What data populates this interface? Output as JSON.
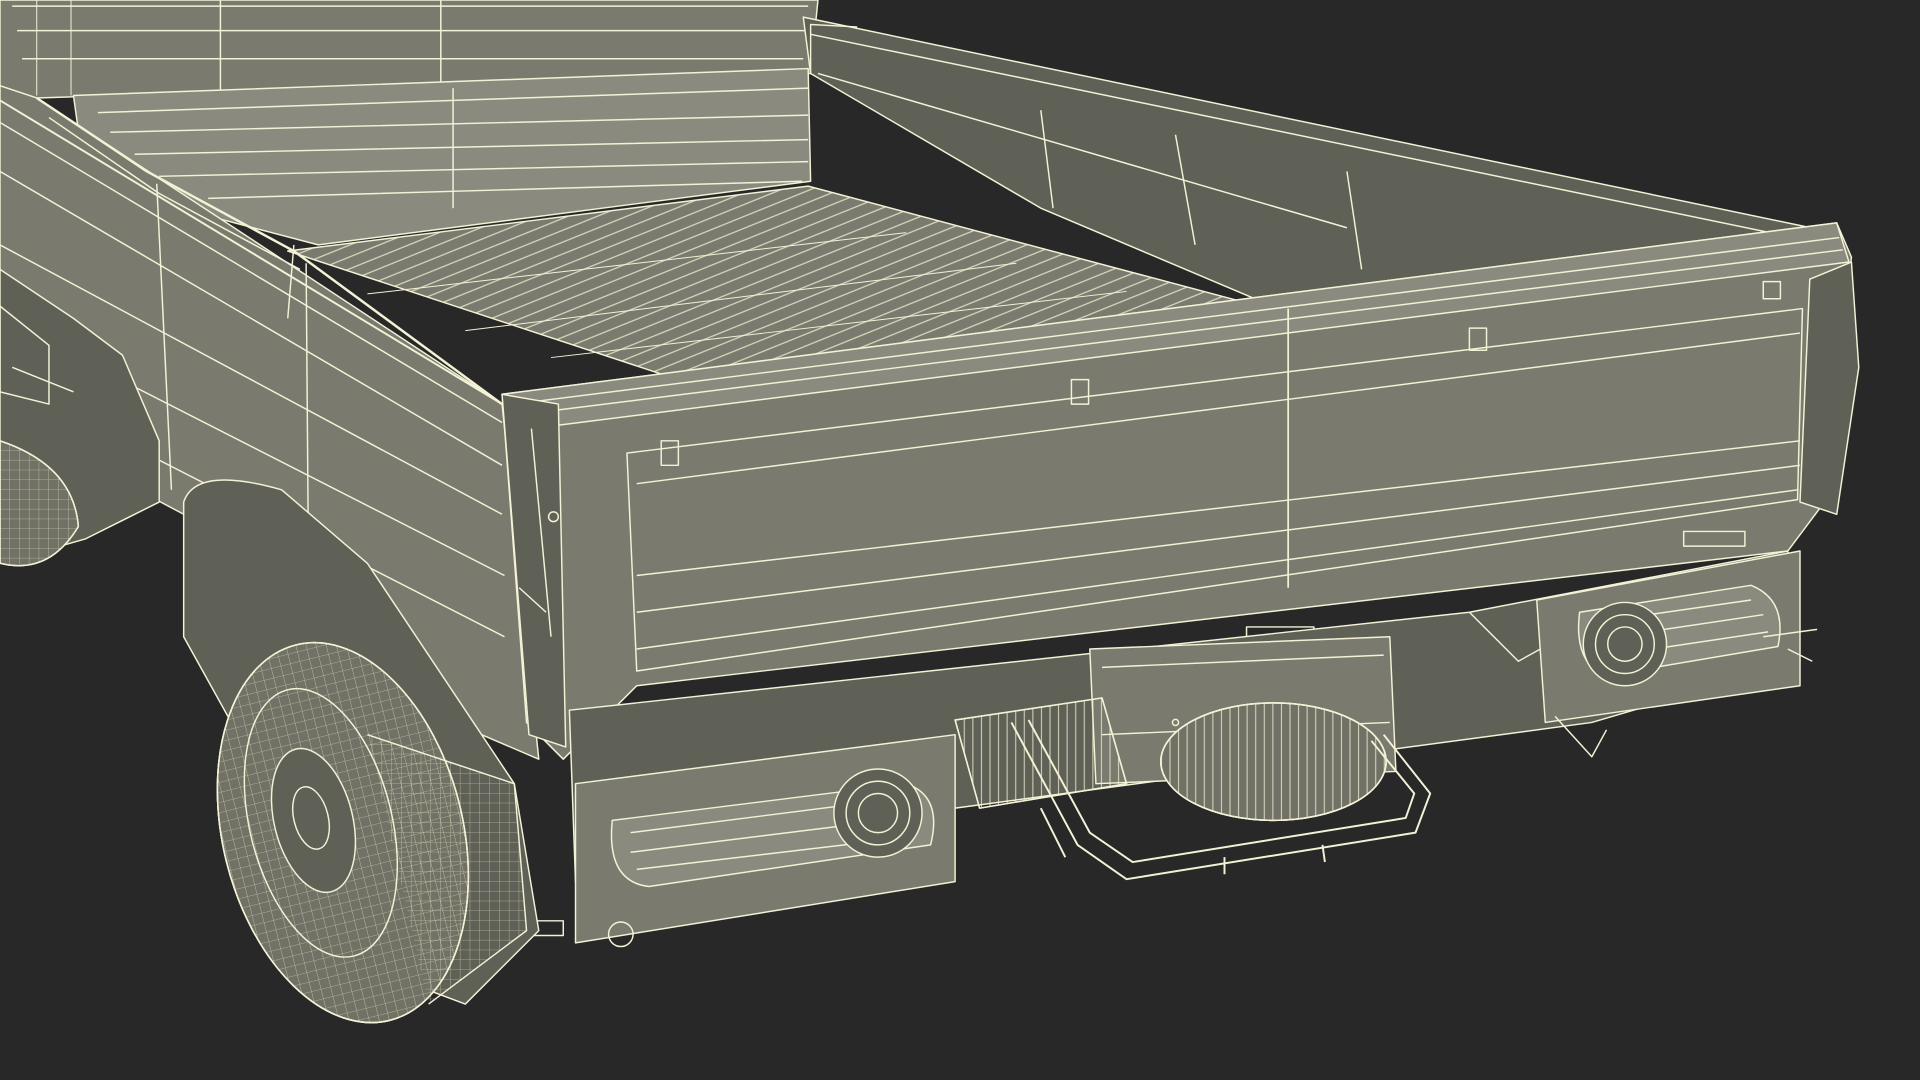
{
  "scene": {
    "subject": "flatbed-truck-wireframe-render",
    "background_color": "#282828",
    "surface_color": "#7a7b6e",
    "surface_dark_color": "#5f6156",
    "surface_light_color": "#8a8b7e",
    "wire_color": "#f3f1d6",
    "tire_color": "#717265"
  }
}
